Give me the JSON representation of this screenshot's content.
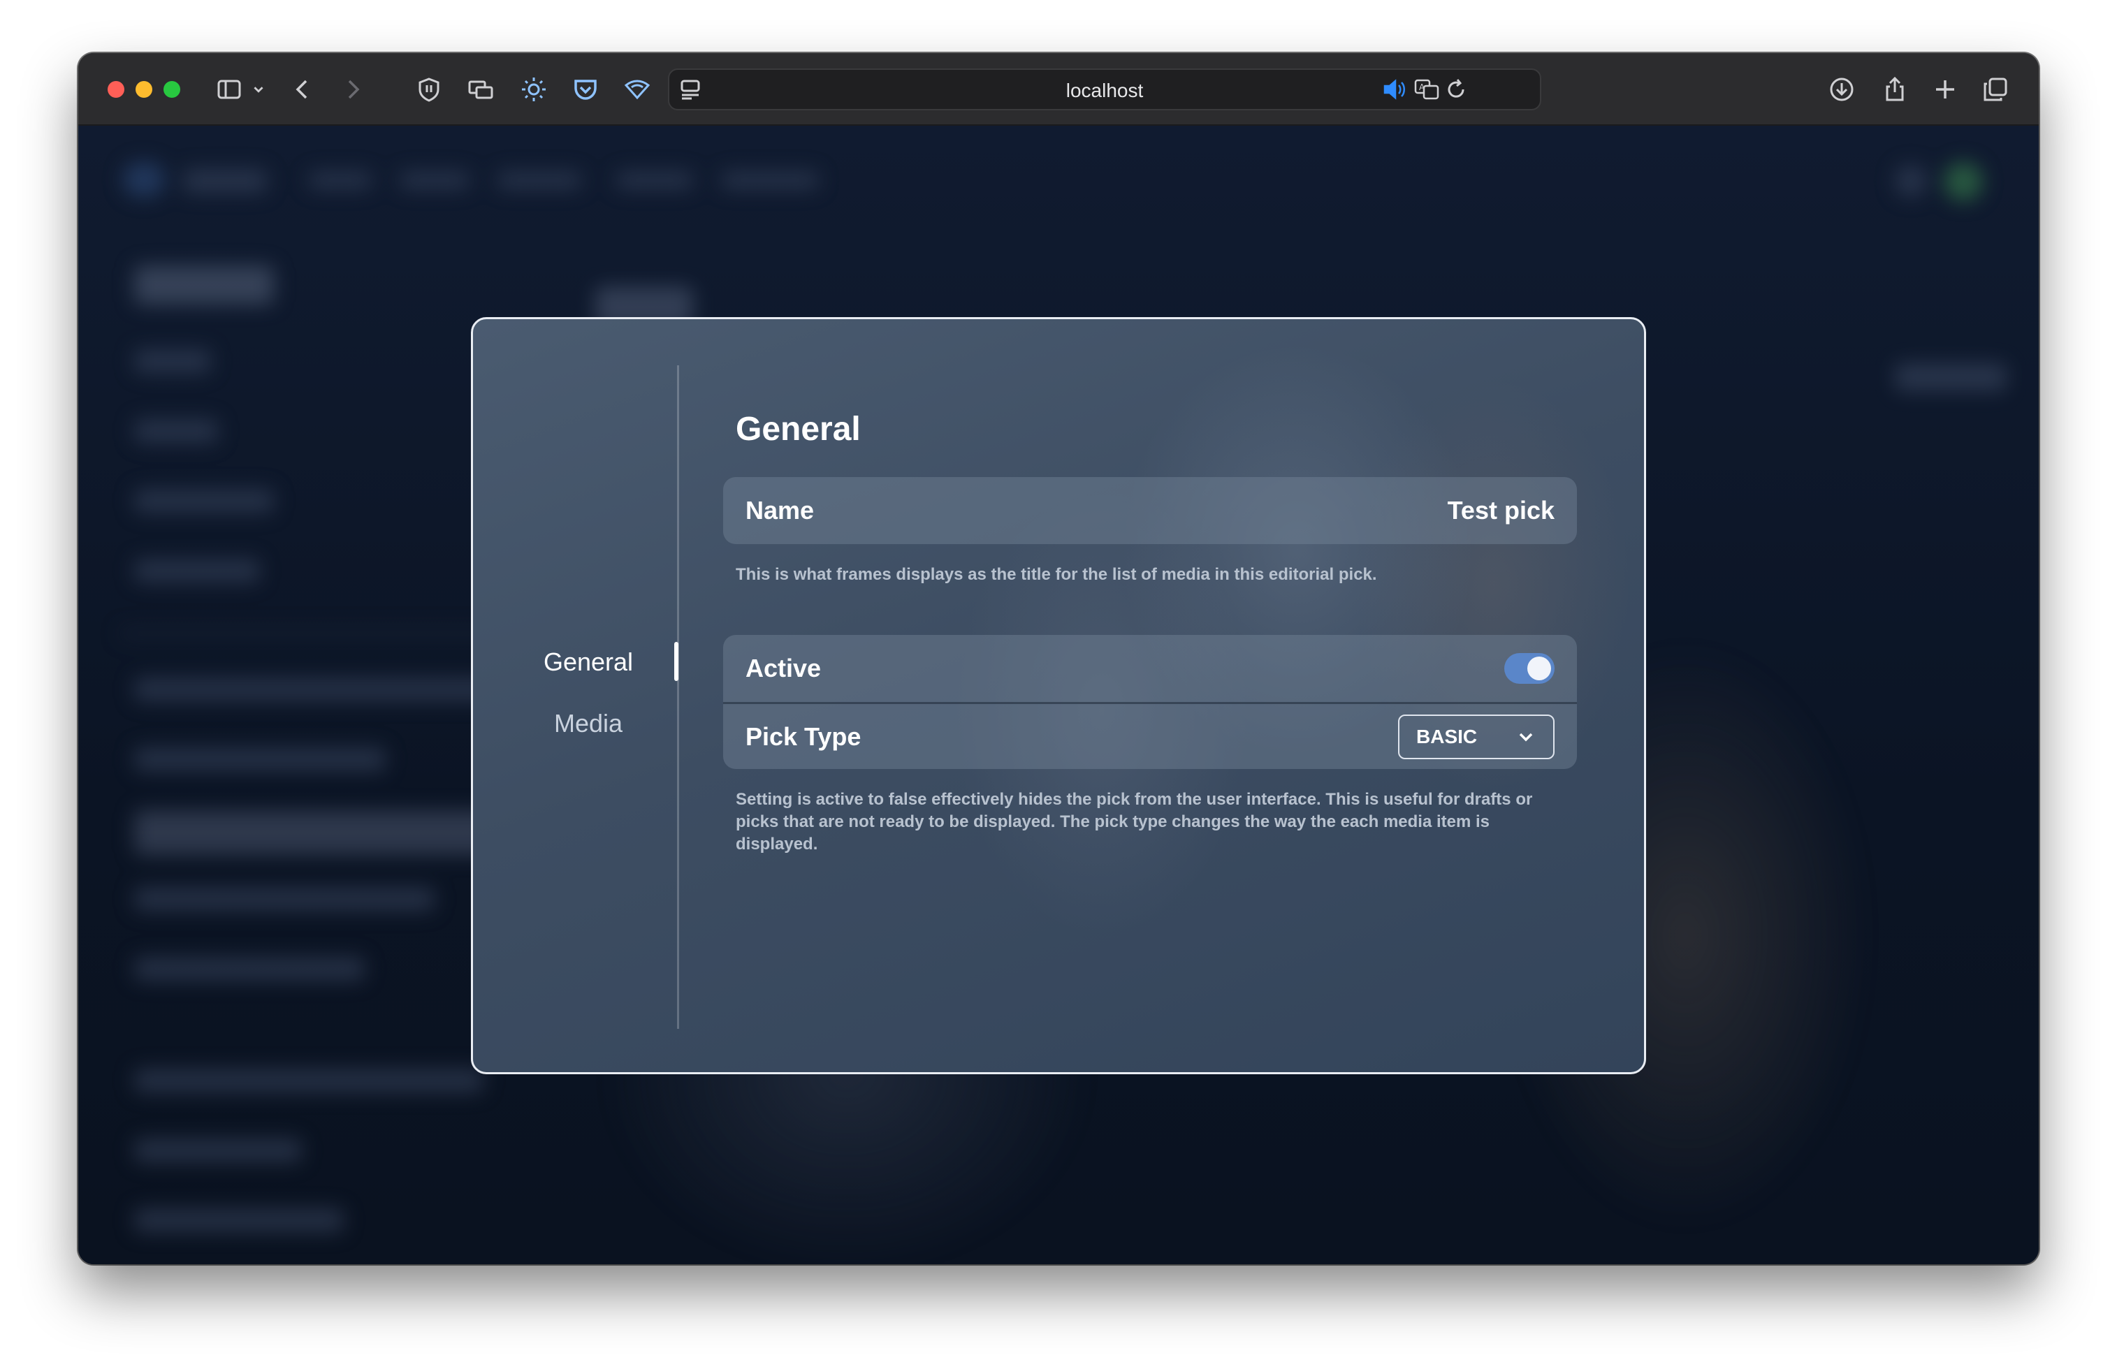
{
  "browser": {
    "url": "localhost",
    "icons": [
      "sidebar-icon",
      "chevron-down-icon",
      "back-icon",
      "forward-icon",
      "shield-icon",
      "screens-icon",
      "brightness-icon",
      "pocket-icon",
      "wifi-extension-icon",
      "reader-icon",
      "speaker-icon",
      "translate-icon",
      "reload-icon",
      "download-icon",
      "share-icon",
      "new-tab-icon",
      "tabs-overview-icon"
    ]
  },
  "modal": {
    "nav": {
      "items": [
        {
          "label": "General",
          "active": true
        },
        {
          "label": "Media",
          "active": false
        }
      ]
    },
    "section_title": "General",
    "name_row": {
      "label": "Name",
      "value": "Test pick"
    },
    "name_help": "This is what frames displays as the title for the list of media in this editorial pick.",
    "active_row": {
      "label": "Active",
      "checked": true
    },
    "pick_type_row": {
      "label": "Pick Type",
      "selected": "BASIC"
    },
    "settings_help": "Setting is active to false effectively hides the pick from the user interface. This is useful for drafts or picks that are not ready to be displayed. The pick type changes the way the each media item is displayed."
  },
  "colors": {
    "toggle_on": "#5a86c9",
    "modal_border": "#e9edf3",
    "window_bg": "#0d1628"
  }
}
